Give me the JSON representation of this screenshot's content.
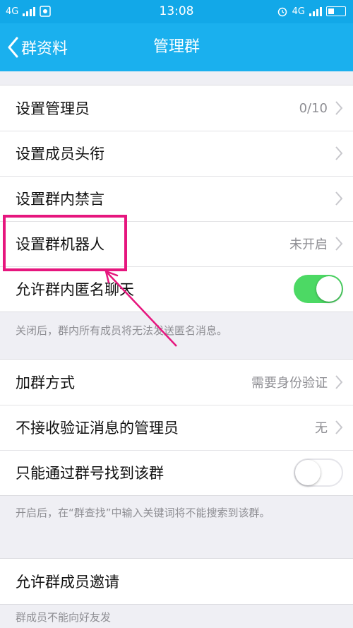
{
  "status_bar": {
    "network_left": "4G",
    "time": "13:08",
    "network_right": "4G"
  },
  "nav": {
    "back_label": "群资料",
    "title": "管理群"
  },
  "group1": [
    {
      "label": "设置管理员",
      "value": "0/10"
    },
    {
      "label": "设置成员头衔",
      "value": ""
    },
    {
      "label": "设置群内禁言",
      "value": ""
    },
    {
      "label": "设置群机器人",
      "value": "未开启"
    },
    {
      "label": "允许群内匿名聊天",
      "toggle": "on"
    }
  ],
  "note1": "关闭后，群内所有成员将无法发送匿名消息。",
  "group2": [
    {
      "label": "加群方式",
      "value": "需要身份验证"
    },
    {
      "label": "不接收验证消息的管理员",
      "value": "无"
    },
    {
      "label": "只能通过群号找到该群",
      "toggle": "off"
    }
  ],
  "note2": "开启后，在“群查找”中输入关键词将不能搜索到该群。",
  "group3": [
    {
      "label": "允许群成员邀请"
    }
  ],
  "note3": "群成员不能向好友发",
  "colors": {
    "status_bar": "#12a8e8",
    "nav_bar": "#1ab0ee",
    "toggle_on": "#4cd964",
    "highlight": "#e6167e"
  }
}
